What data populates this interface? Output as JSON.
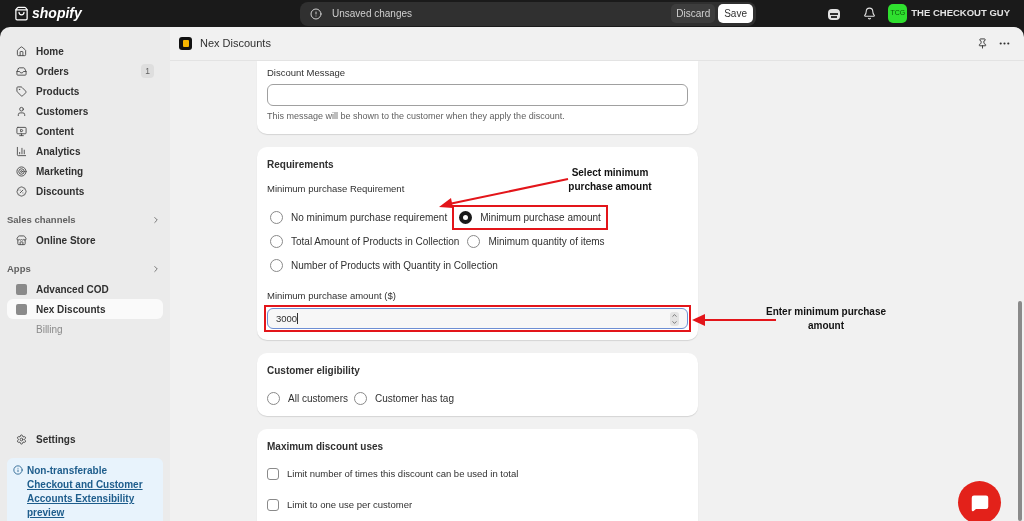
{
  "topbar": {
    "logo": "shopify",
    "notice": "Unsaved changes",
    "buttons": [
      {
        "label": "Discard",
        "kind": "secondary"
      },
      {
        "label": "Save",
        "kind": "primary"
      }
    ],
    "avatar": "TCG",
    "store_name": "THE CHECKOUT GUY"
  },
  "sidebar": {
    "items": [
      {
        "label": "Home",
        "selected": false
      },
      {
        "label": "Orders",
        "badge": "1",
        "selected": false
      },
      {
        "label": "Products",
        "selected": false
      },
      {
        "label": "Customers",
        "selected": false
      },
      {
        "label": "Content",
        "selected": false
      },
      {
        "label": "Analytics",
        "selected": false
      },
      {
        "label": "Marketing",
        "selected": false
      },
      {
        "label": "Discounts",
        "selected": false
      }
    ],
    "sections": [
      {
        "title": "Sales channels",
        "items": [
          {
            "label": "Online Store",
            "kind": "item",
            "selected": false
          }
        ]
      },
      {
        "title": "Apps",
        "items": [
          {
            "label": "Advanced COD",
            "kind": "item",
            "selected": false
          },
          {
            "label": "Nex Discounts",
            "kind": "item",
            "selected": true
          },
          {
            "label": "Billing",
            "kind": "sub",
            "selected": false
          }
        ]
      }
    ],
    "settings": "Settings",
    "banner": {
      "title": "Non-transferable",
      "link": "Checkout and Customer Accounts Extensibility preview"
    }
  },
  "app_header": {
    "title": "Nex Discounts"
  },
  "message_card": {
    "label": "Discount Message",
    "help": "This message will be shown to the customer when they apply the discount."
  },
  "requirements": {
    "title": "Requirements",
    "subtitle": "Minimum purchase Requirement",
    "option_rows": [
      [
        {
          "label": "No minimum purchase requirement",
          "selected": false,
          "highlighted": false
        },
        {
          "label": "Minimum purchase amount",
          "selected": true,
          "highlighted": true
        }
      ],
      [
        {
          "label": "Total Amount of Products in Collection",
          "selected": false,
          "highlighted": false
        },
        {
          "label": "Minimum quantity of items",
          "selected": false,
          "highlighted": false
        }
      ],
      [
        {
          "label": "Number of Products with Quantity in Collection",
          "selected": false,
          "highlighted": false
        }
      ]
    ],
    "amount_field": {
      "label": "Minimum purchase amount ($)",
      "value": "3000",
      "highlighted": true
    }
  },
  "eligibility": {
    "title": "Customer eligibility",
    "options": [
      {
        "label": "All customers",
        "selected": false
      },
      {
        "label": "Customer has tag",
        "selected": false
      }
    ]
  },
  "max_uses": {
    "title": "Maximum discount uses",
    "options": [
      {
        "label": "Limit number of times this discount can be used in total",
        "checked": false
      },
      {
        "label": "Limit to one use per customer",
        "checked": false
      }
    ]
  },
  "annotations": [
    {
      "text": "Select minimum purchase amount"
    },
    {
      "text": "Enter minimum purchase amount"
    }
  ]
}
